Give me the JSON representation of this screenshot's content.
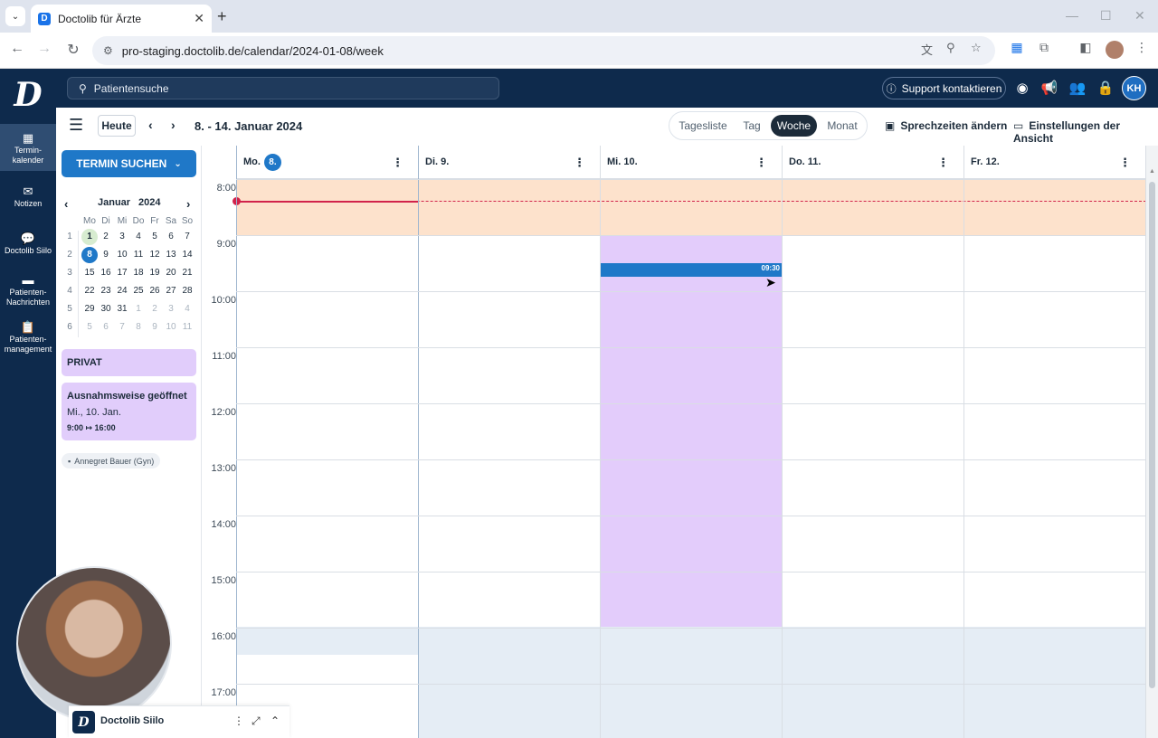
{
  "browser": {
    "tab_title": "Doctolib für Ärzte",
    "favicon_letter": "D",
    "url": "pro-staging.doctolib.de/calendar/2024-01-08/week"
  },
  "app": {
    "logo_letter": "D",
    "search_placeholder": "Patientensuche",
    "support_label": "Support kontaktieren",
    "avatar_initials": "KH"
  },
  "leftnav": [
    {
      "label": "Termin-\nkalender",
      "icon": "calendar-icon"
    },
    {
      "label": "Notizen",
      "icon": "mail-icon"
    },
    {
      "label": "Doctolib Siilo",
      "icon": "chat-icon"
    },
    {
      "label": "Patienten-\nNachrichten",
      "icon": "message-icon"
    },
    {
      "label": "Patienten-\nmanagement",
      "icon": "clipboard-icon"
    }
  ],
  "subbar": {
    "today_label": "Heute",
    "date_range": "8. - 14. Januar 2024",
    "views": [
      "Tagesliste",
      "Tag",
      "Woche",
      "Monat"
    ],
    "active_view": "Woche",
    "sprechzeiten_label": "Sprechzeiten ändern",
    "einstellungen_label": "Einstellungen der Ansicht"
  },
  "sidepanel": {
    "termin_button": "TERMIN SUCHEN",
    "month": "Januar",
    "year": "2024",
    "weekdays": [
      "Mo",
      "Di",
      "Mi",
      "Do",
      "Fr",
      "Sa",
      "So"
    ],
    "weeks": [
      {
        "wk": "1",
        "days": [
          "1",
          "2",
          "3",
          "4",
          "5",
          "6",
          "7"
        ]
      },
      {
        "wk": "2",
        "days": [
          "8",
          "9",
          "10",
          "11",
          "12",
          "13",
          "14"
        ]
      },
      {
        "wk": "3",
        "days": [
          "15",
          "16",
          "17",
          "18",
          "19",
          "20",
          "21"
        ]
      },
      {
        "wk": "4",
        "days": [
          "22",
          "23",
          "24",
          "25",
          "26",
          "27",
          "28"
        ]
      },
      {
        "wk": "5",
        "days": [
          "29",
          "30",
          "31",
          "1",
          "2",
          "3",
          "4"
        ]
      },
      {
        "wk": "6",
        "days": [
          "5",
          "6",
          "7",
          "8",
          "9",
          "10",
          "11"
        ]
      }
    ],
    "privat_label": "PRIVAT",
    "exception_title": "Ausnahmsweise geöffnet",
    "exception_date": "Mi., 10. Jan.",
    "exception_hours": "9:00 ↦ 16:00",
    "agenda_chip": "Annegret Bauer (Gyn)"
  },
  "calendar": {
    "days": [
      {
        "label": "Mo.",
        "badge": "8."
      },
      {
        "label": "Di. 9.",
        "badge": ""
      },
      {
        "label": "Mi. 10.",
        "badge": ""
      },
      {
        "label": "Do. 11.",
        "badge": ""
      },
      {
        "label": "Fr. 12.",
        "badge": ""
      }
    ],
    "hours": [
      "8:00",
      "9:00",
      "10:00",
      "11:00",
      "12:00",
      "13:00",
      "14:00",
      "15:00",
      "16:00",
      "17:00"
    ],
    "event_time": "09:30",
    "colors": {
      "closed": "#fde2cc",
      "exception_open": "#e3ccfb",
      "after_hours": "#e5edf5",
      "now_line": "#d1234b",
      "event": "#1f78c8"
    }
  },
  "siilo": {
    "logo_letter": "D",
    "title": "Doctolib Siilo"
  }
}
